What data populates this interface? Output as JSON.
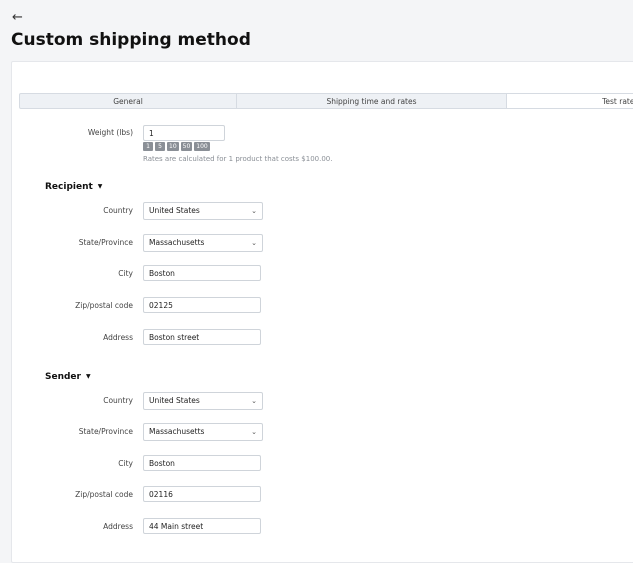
{
  "header": {
    "back_glyph": "←",
    "title": "Custom shipping method"
  },
  "tabs": [
    {
      "label": "General",
      "active": false
    },
    {
      "label": "Shipping time and rates",
      "active": false
    },
    {
      "label": "Test rate c",
      "active": true
    }
  ],
  "weight": {
    "label": "Weight (lbs)",
    "value": "1",
    "quick_values": [
      "1",
      "5",
      "10",
      "50",
      "100"
    ],
    "hint": "Rates are calculated for 1 product that costs $100.00."
  },
  "recipient": {
    "title": "Recipient",
    "country_label": "Country",
    "country": "United States",
    "state_label": "State/Province",
    "state": "Massachusetts",
    "city_label": "City",
    "city": "Boston",
    "zip_label": "Zip/postal code",
    "zip": "02125",
    "address_label": "Address",
    "address": "Boston street"
  },
  "sender": {
    "title": "Sender",
    "country_label": "Country",
    "country": "United States",
    "state_label": "State/Province",
    "state": "Massachusetts",
    "city_label": "City",
    "city": "Boston",
    "zip_label": "Zip/postal code",
    "zip": "02116",
    "address_label": "Address",
    "address": "44 Main street"
  },
  "colors": {
    "background": "#f4f5f7",
    "chip": "#8a8f96",
    "tab_bar": "#eef1f5"
  }
}
